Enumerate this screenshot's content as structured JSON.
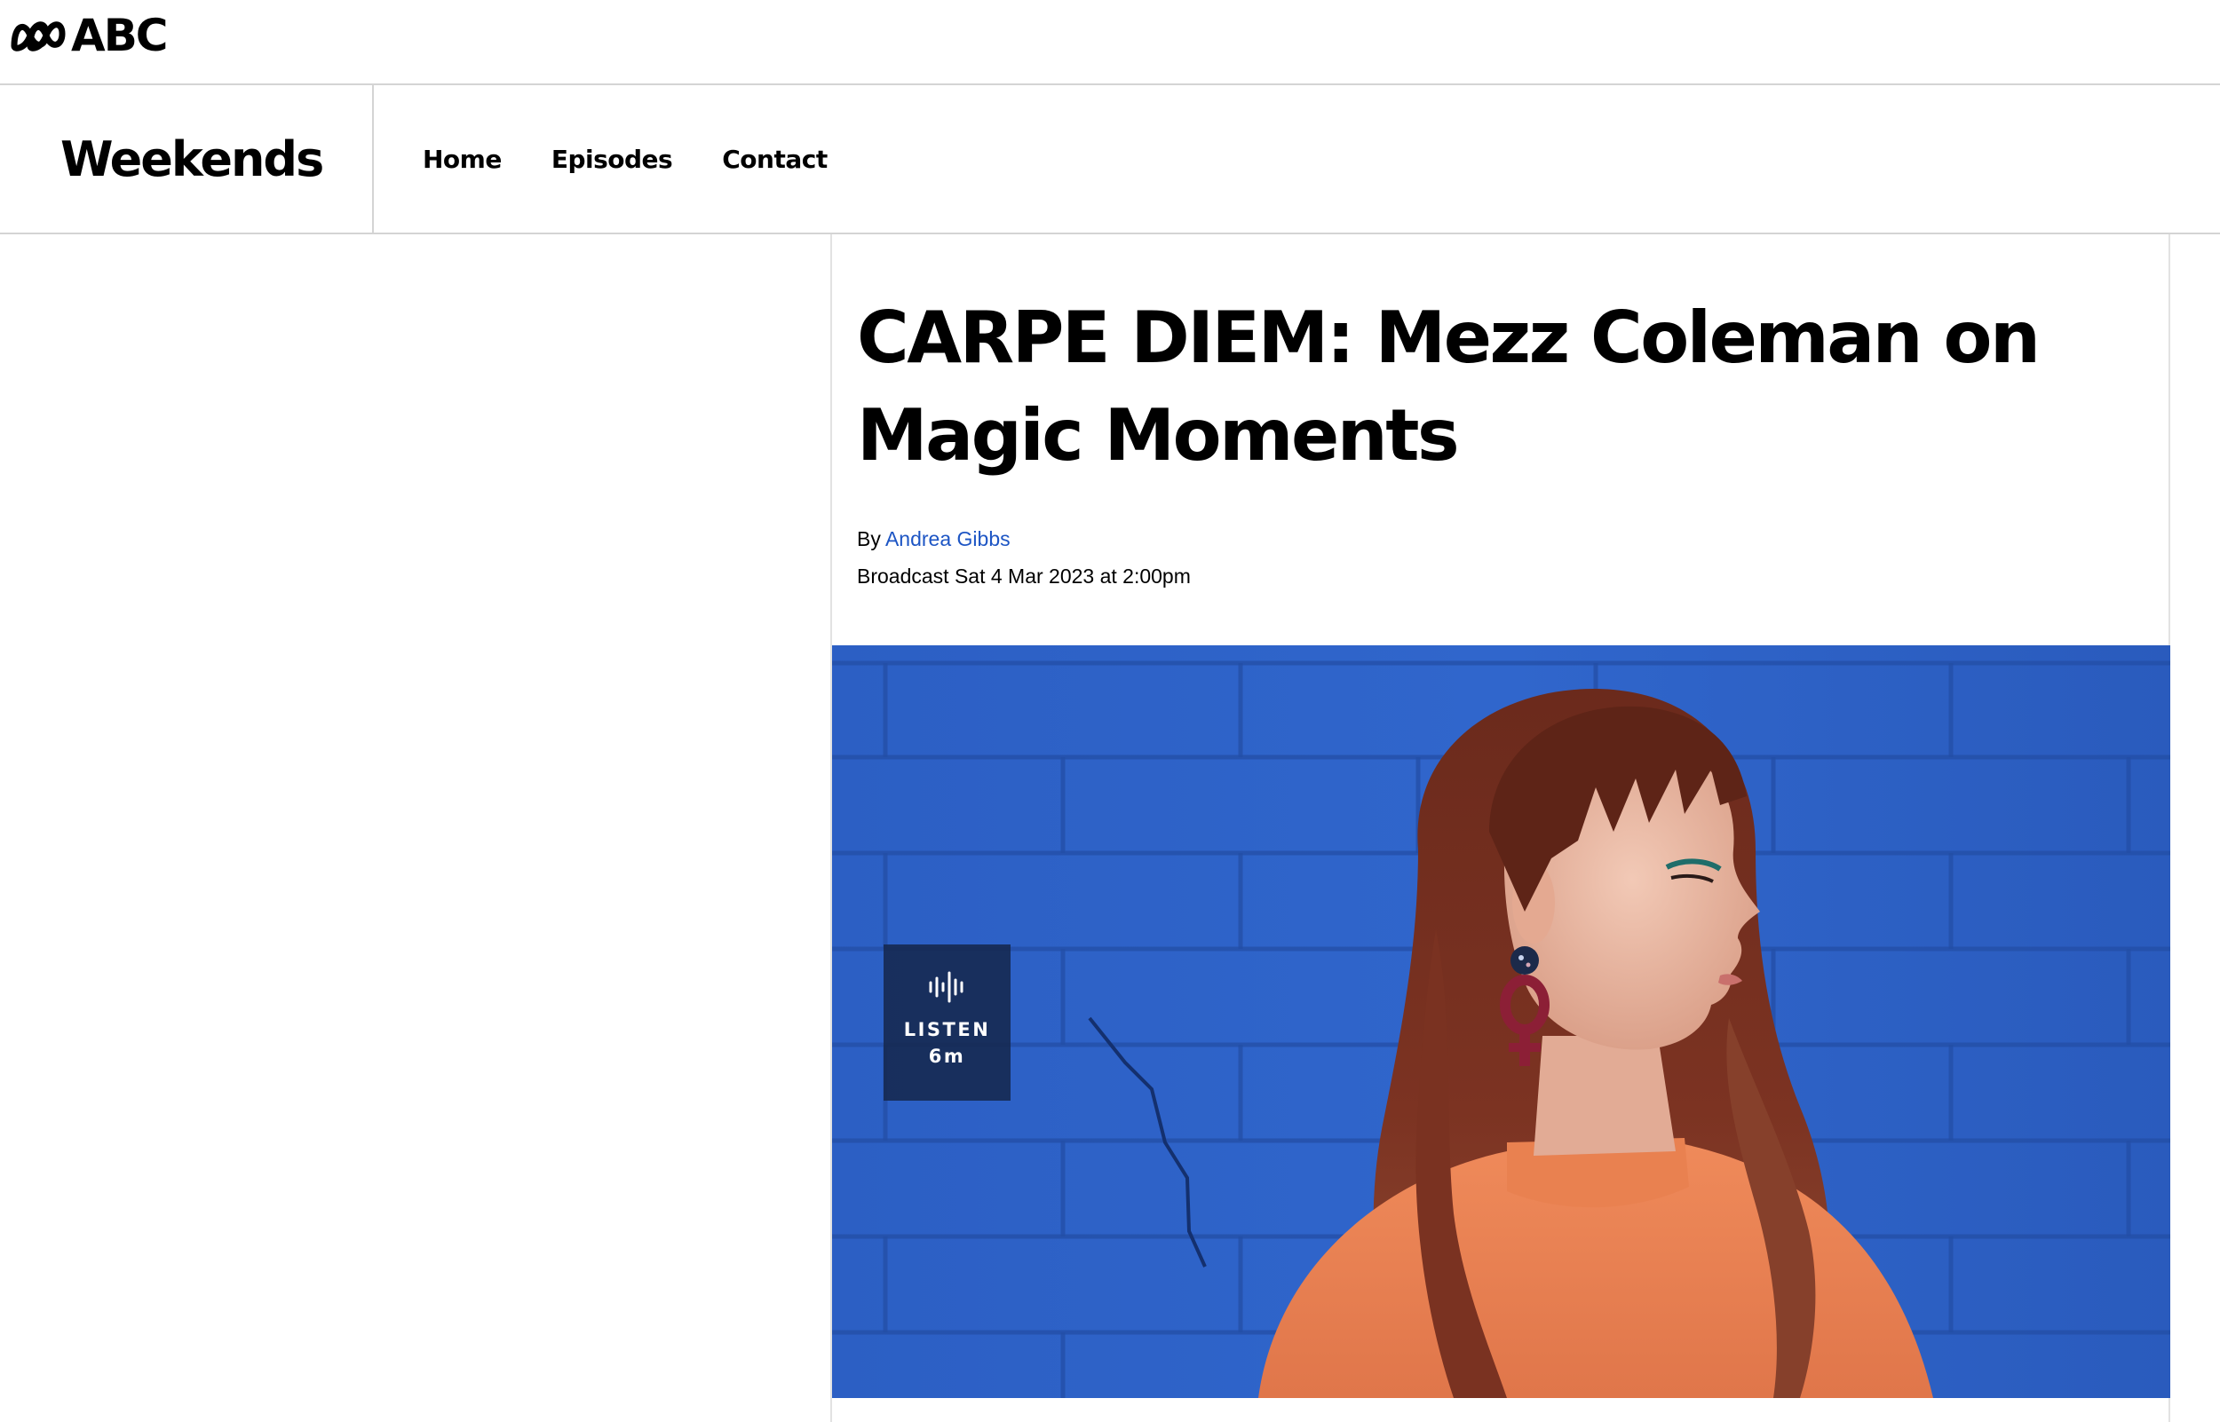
{
  "abc_bar": {
    "logo_text": "ABC",
    "logo_icon": "abc-lissajous-icon"
  },
  "program": {
    "title": "Weekends",
    "nav": {
      "home": "Home",
      "episodes": "Episodes",
      "contact": "Contact"
    }
  },
  "article": {
    "headline": "CARPE DIEM: Mezz Coleman on Magic Moments",
    "byline_prefix": "By",
    "author": "Andrea Gibbs",
    "broadcast": "Broadcast Sat 4 Mar 2023 at 2:00pm",
    "hero": {
      "alt": "Woman with long auburn hair and fringe, wearing an orange jumper and red venus-symbol earrings, in profile against a blue painted brick wall",
      "listen_icon": "audio-wave-icon",
      "listen_label": "LISTEN",
      "listen_duration": "6m"
    }
  },
  "colors": {
    "link": "#1d55c4",
    "brick_wall": "#2e62c8",
    "badge_bg": "#16284e"
  }
}
